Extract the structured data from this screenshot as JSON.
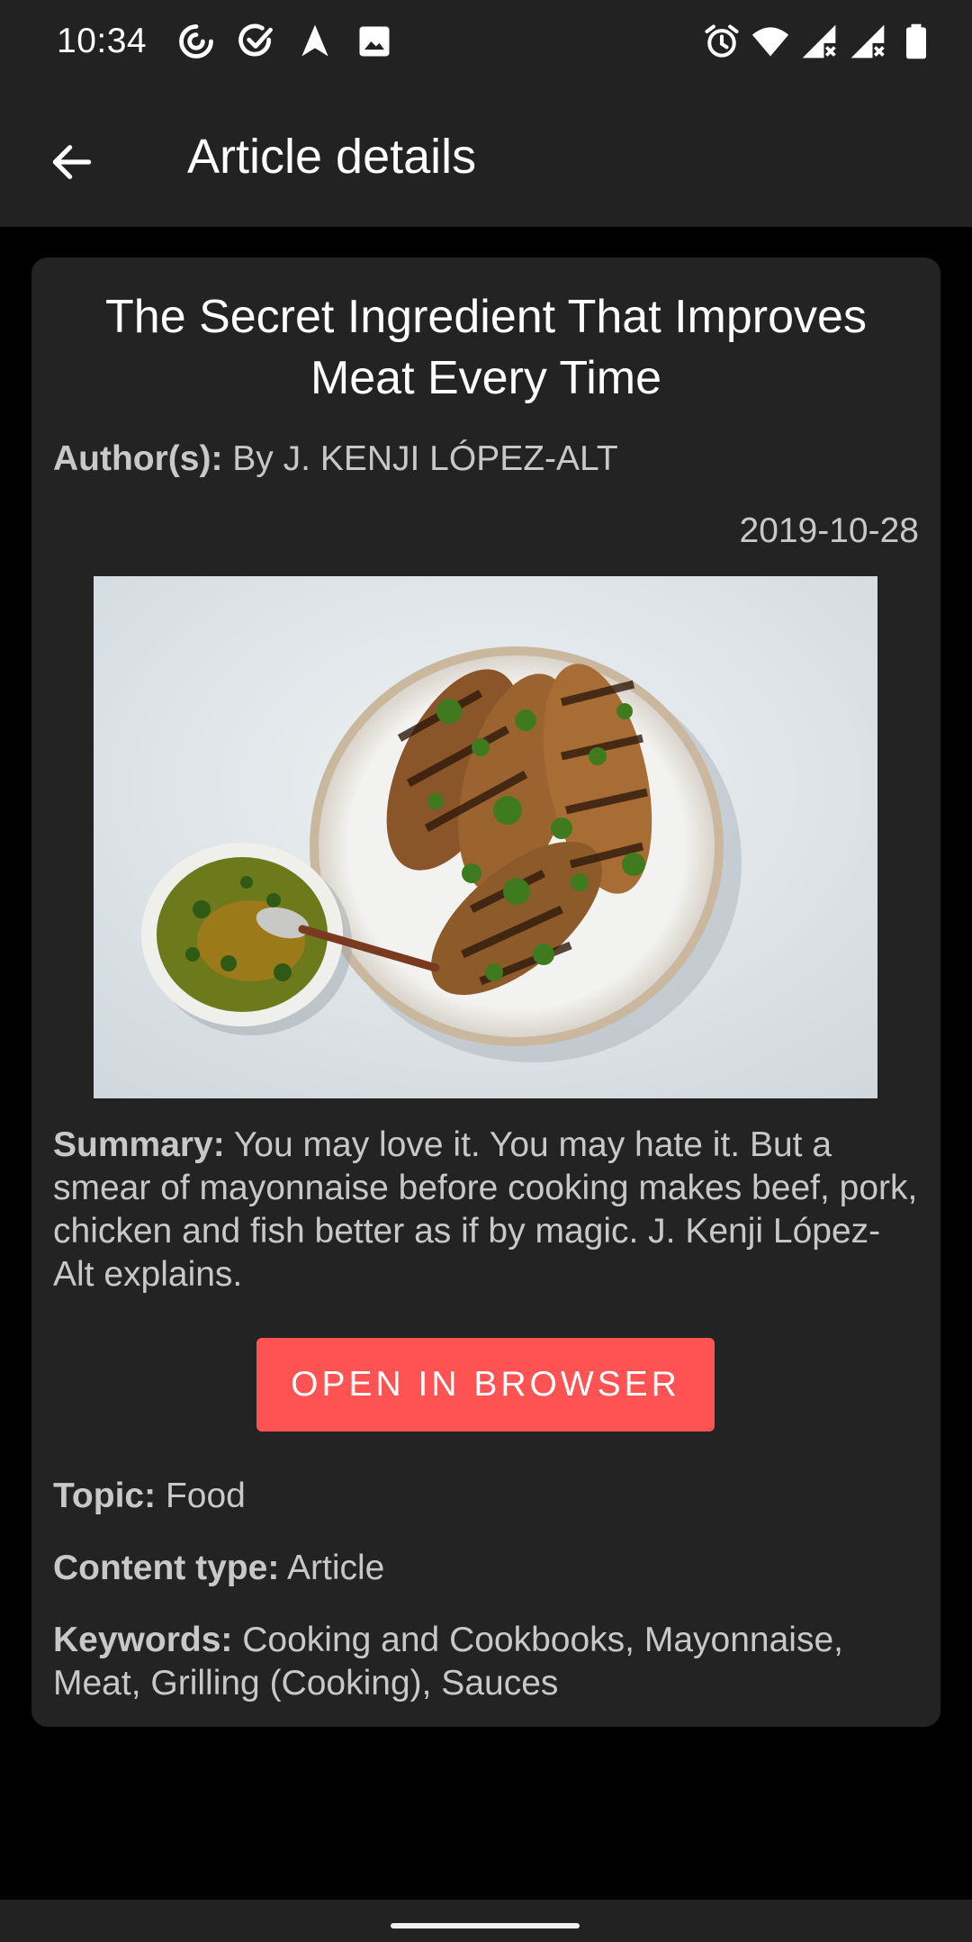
{
  "status_bar": {
    "time": "10:34",
    "left_icons": [
      "sync-icon",
      "check-circle-icon",
      "navigation-icon",
      "image-icon"
    ],
    "right_icons": [
      "alarm-icon",
      "wifi-icon",
      "signal-icon",
      "signal-icon",
      "battery-icon"
    ]
  },
  "app_bar": {
    "title": "Article details",
    "back_icon": "arrow-back-icon"
  },
  "article": {
    "title": "The Secret Ingredient That Improves Meat Every Time",
    "author_label": "Author(s):",
    "author": "By J. KENJI LÓPEZ-ALT",
    "date": "2019-10-28",
    "summary_label": "Summary:",
    "summary": "You may love it. You may hate it. But a smear of mayonnaise before cooking makes beef, pork, chicken and fish better as if by magic. J. Kenji López-Alt explains.",
    "open_button": "OPEN IN BROWSER",
    "topic_label": "Topic:",
    "topic": "Food",
    "content_type_label": "Content type:",
    "content_type": "Article",
    "keywords_label": "Keywords:",
    "keywords": "Cooking and Cookbooks, Mayonnaise, Meat, Grilling (Cooking), Sauces"
  },
  "colors": {
    "background": "#000000",
    "surface": "#222222",
    "card": "#232323",
    "accent": "#ff5252",
    "text_primary": "#ffffff",
    "text_secondary": "#c8c8c8"
  }
}
